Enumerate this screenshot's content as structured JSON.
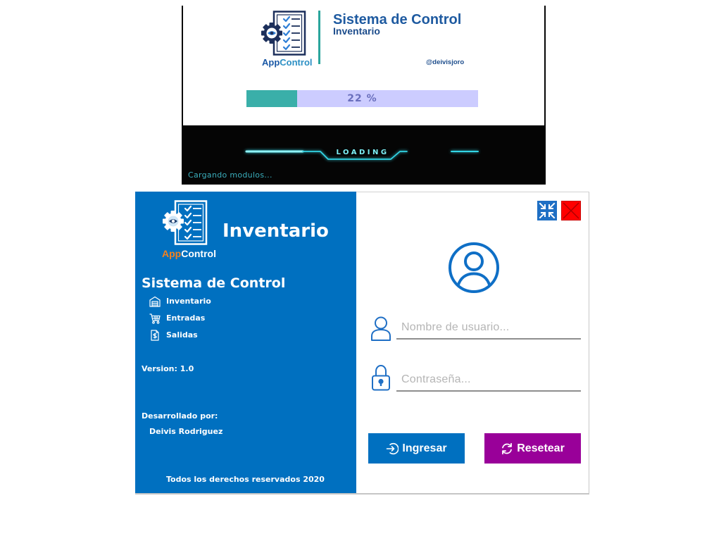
{
  "colors": {
    "sidebar_bg": "#0070c0",
    "brand_orange": "#f5821f",
    "login_button": "#0070c0",
    "reset_button": "#990099",
    "close_button": "#ff0000",
    "progress_fill": "#3aafa9",
    "progress_track": "#ccccff",
    "neon": "#33d6e6"
  },
  "splash": {
    "logo": {
      "icon": "clipboard-gear-eye-icon",
      "text_app": "App",
      "text_control": "Control"
    },
    "title": "Sistema de Control",
    "subtitle": "Inventario",
    "author": "@deivisjoro",
    "progress": {
      "percent": 22,
      "label": "22 %"
    },
    "loading_text": "LOADING",
    "status": "Cargando modulos..."
  },
  "login": {
    "sidebar": {
      "logo": {
        "icon": "clipboard-gear-eye-icon",
        "text_app": "App",
        "text_control": "Control"
      },
      "app_title": "Inventario",
      "system_title": "Sistema de Control",
      "modules": [
        {
          "label": "Inventario",
          "icon": "warehouse-icon"
        },
        {
          "label": "Entradas",
          "icon": "shopping-cart-icon"
        },
        {
          "label": "Salidas",
          "icon": "invoice-dollar-icon"
        }
      ],
      "version": "Version: 1.0",
      "developed_by": "Desarrollado por:",
      "developer": "Deivis Rodriguez",
      "copyright": "Todos los derechos reservados 2020"
    },
    "window_controls": {
      "minimize_icon": "compress-icon",
      "close_icon": "close-icon"
    },
    "avatar_icon": "user-circle-icon",
    "username": {
      "icon": "user-icon",
      "placeholder": "Nombre de usuario..."
    },
    "password": {
      "icon": "lock-icon",
      "placeholder": "Contraseña..."
    },
    "buttons": {
      "login": {
        "label": "Ingresar",
        "icon": "sign-in-icon"
      },
      "reset": {
        "label": "Resetear",
        "icon": "refresh-icon"
      }
    }
  }
}
